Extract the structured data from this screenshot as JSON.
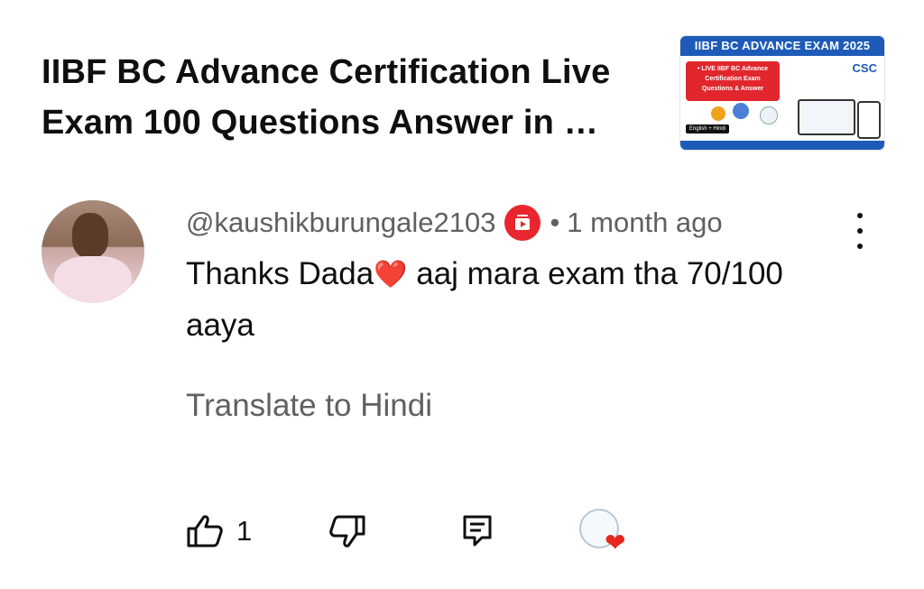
{
  "video": {
    "title": "IIBF BC Advance Certification Live Exam 100 Questions Answer in …",
    "thumbnail": {
      "banner": "IIBF BC ADVANCE EXAM 2025",
      "red_box_lines": [
        "• LIVE IIBF BC Advance",
        "Certification Exam",
        "Questions & Answer"
      ],
      "logo_text": "CSC",
      "lang_tag": "English + Hindi"
    }
  },
  "comment": {
    "author": "@kaushikburungale2103",
    "separator": "•",
    "time": "1 month ago",
    "text_before_emoji": "Thanks Dada",
    "emoji": "❤️",
    "text_after_emoji": " aaj mara exam tha 70/100 aaya",
    "translate_label": "Translate to Hindi"
  },
  "actions": {
    "like_count": "1",
    "creator_heart": "❤"
  },
  "colors": {
    "member_badge": "#e9262f",
    "secondary_text": "#606060",
    "heart": "#e8261f"
  },
  "icons": [
    "member-badge-icon",
    "more-vert-icon",
    "thumb-up-icon",
    "thumb-down-icon",
    "reply-icon",
    "creator-heart-icon"
  ]
}
